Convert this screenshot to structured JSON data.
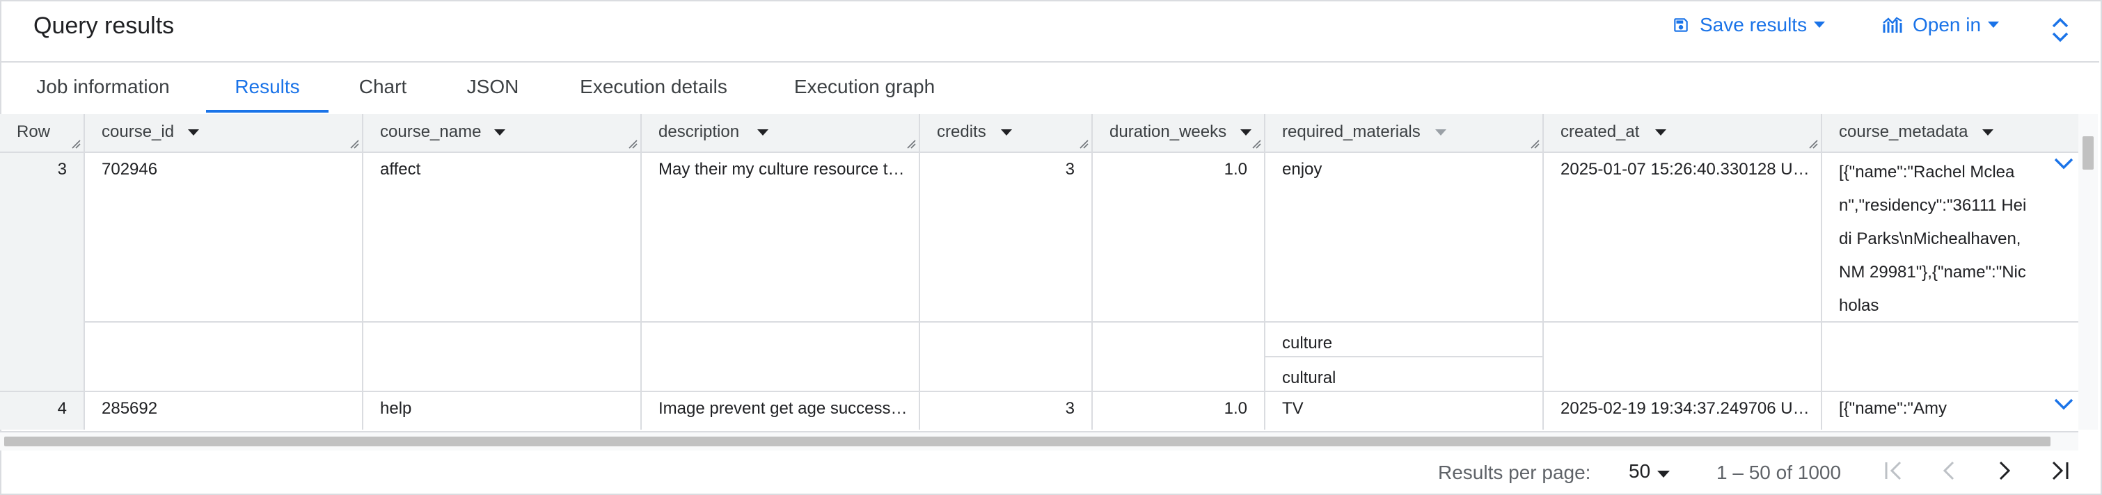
{
  "header": {
    "title": "Query results",
    "save_label": "Save results",
    "open_label": "Open in"
  },
  "tabs": [
    {
      "label": "Job information",
      "active": false
    },
    {
      "label": "Results",
      "active": true
    },
    {
      "label": "Chart",
      "active": false
    },
    {
      "label": "JSON",
      "active": false
    },
    {
      "label": "Execution details",
      "active": false
    },
    {
      "label": "Execution graph",
      "active": false
    }
  ],
  "grid": {
    "columns": [
      "Row",
      "course_id",
      "course_name",
      "description",
      "credits",
      "duration_weeks",
      "required_materials",
      "created_at",
      "course_metadata"
    ],
    "rows": [
      {
        "row": "3",
        "course_id": "702946",
        "course_name": "affect",
        "description": "May their my culture resource t…",
        "credits": "3",
        "duration_weeks": "1.0",
        "required_materials": [
          "enjoy",
          "culture",
          "cultural"
        ],
        "created_at": "2025-01-07 15:26:40.330128 U…",
        "course_metadata": "[{\"name\":\"Rachel Mclean\",\"residency\":\"36111 Heidi Parks\\nMichealhaven, NM 29981\"},{\"name\":\"Nicholas"
      },
      {
        "row": "4",
        "course_id": "285692",
        "course_name": "help",
        "description": "Image prevent get age success…",
        "credits": "3",
        "duration_weeks": "1.0",
        "required_materials": [
          "TV"
        ],
        "created_at": "2025-02-19 19:34:37.249706 U…",
        "course_metadata": "[{\"name\":\"Amy"
      }
    ]
  },
  "footer": {
    "per_page_label": "Results per page:",
    "per_page_value": "50",
    "range": "1 – 50 of 1000"
  },
  "colors": {
    "accent": "#1a73e8",
    "border": "#dadce0",
    "header_bg": "#f1f3f4"
  },
  "icons": [
    "save-icon",
    "chart-icon",
    "caret-down-icon",
    "unfold-icon",
    "sort-arrow-icon",
    "resize-handle-icon",
    "chevron-down-icon",
    "first-page-icon",
    "prev-page-icon",
    "next-page-icon",
    "last-page-icon"
  ]
}
